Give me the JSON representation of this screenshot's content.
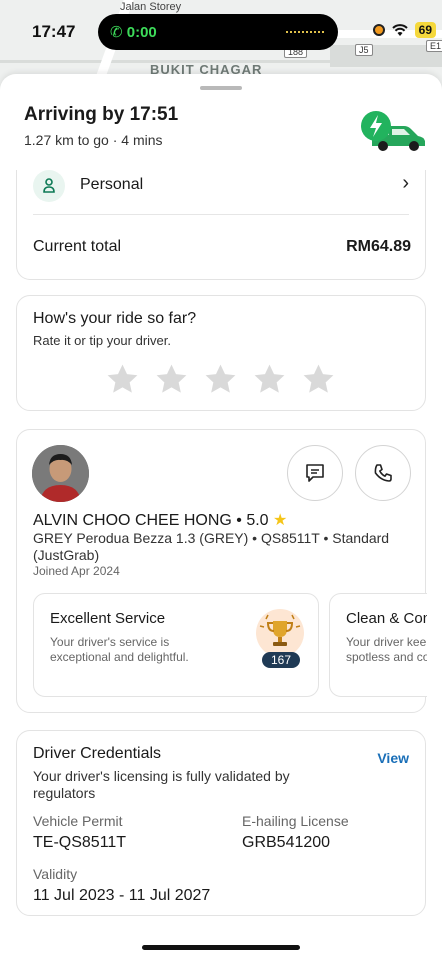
{
  "status_bar": {
    "time": "17:47",
    "call_timer": "0:00",
    "battery": "69"
  },
  "map": {
    "street_label": "Jalan Storey",
    "area_label": "BUKIT CHAGAR",
    "route_shields": [
      "J5",
      "188",
      "E1"
    ]
  },
  "trip": {
    "title": "Arriving by 17:51",
    "subtitle": "1.27 km to go · 4 mins"
  },
  "payment": {
    "profile_label": "Personal",
    "total_label": "Current total",
    "total_value": "RM64.89"
  },
  "rating": {
    "title": "How's your ride so far?",
    "subtitle": "Rate it or tip your driver.",
    "stars_selected": 0,
    "star_count": 5
  },
  "driver": {
    "name_line": "ALVIN CHOO CHEE HONG • 5.0",
    "vehicle": "GREY Perodua Bezza 1.3 (GREY) • QS8511T • Standard (JustGrab)",
    "joined": "Joined Apr 2024",
    "compliments": [
      {
        "title": "Excellent Service",
        "desc": "Your driver's service is exceptional and delightful.",
        "count": "167"
      },
      {
        "title": "Clean & Comfy",
        "desc": "Your driver keeps the car spotless and comfy."
      }
    ]
  },
  "credentials": {
    "title": "Driver Credentials",
    "view_label": "View",
    "description": "Your driver's licensing is fully validated by regulators",
    "permit_label": "Vehicle Permit",
    "permit_value": "TE-QS8511T",
    "license_label": "E-hailing License",
    "license_value": "GRB541200",
    "validity_label": "Validity",
    "validity_value": "11 Jul 2023 - 11 Jul 2027"
  },
  "colors": {
    "accent_green": "#00b14f",
    "link_blue": "#1a6fb8",
    "star_grey": "#d9d9d9",
    "rating_star": "#f5c518"
  }
}
